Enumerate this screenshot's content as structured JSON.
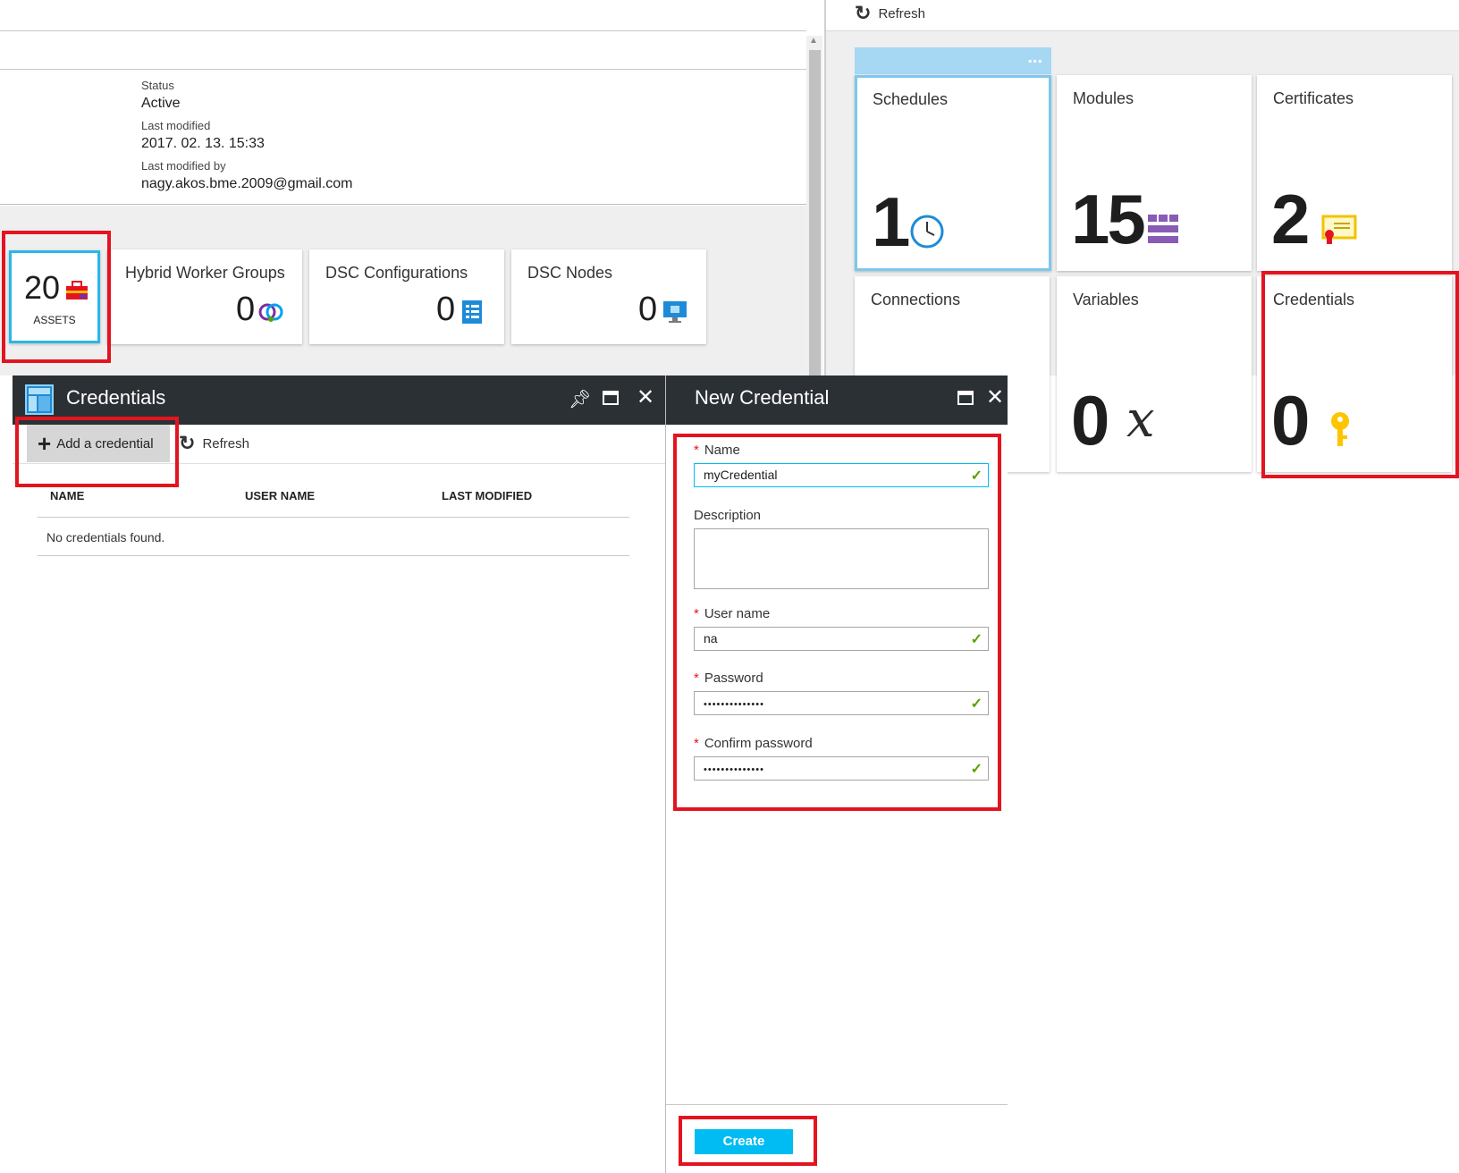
{
  "details": {
    "status_label": "Status",
    "status_value": "Active",
    "modified_label": "Last modified",
    "modified_value": "2017. 02. 13. 15:33",
    "modified_by_label": "Last modified by",
    "modified_by_value": "nagy.akos.bme.2009@gmail.com"
  },
  "summary_tiles": {
    "assets": {
      "count": "20",
      "label": "ASSETS",
      "icon": "toolbox-icon"
    },
    "hybrid": {
      "title": "Hybrid Worker Groups",
      "count": "0",
      "icon": "hybrid-worker-icon"
    },
    "dsc_configurations": {
      "title": "DSC Configurations",
      "count": "0",
      "icon": "checklist-icon"
    },
    "dsc_nodes": {
      "title": "DSC Nodes",
      "count": "0",
      "icon": "monitor-icon"
    }
  },
  "assets_panel": {
    "refresh_label": "Refresh",
    "more_label": "...",
    "tiles": [
      {
        "title": "Schedules",
        "count": "1",
        "icon": "clock-icon"
      },
      {
        "title": "Modules",
        "count": "15",
        "icon": "modules-grid-icon"
      },
      {
        "title": "Certificates",
        "count": "2",
        "icon": "certificate-icon"
      },
      {
        "title": "Connections",
        "count": "",
        "icon": ""
      },
      {
        "title": "Variables",
        "count": "0",
        "icon": "variable-x-icon",
        "symbol": "x"
      },
      {
        "title": "Credentials",
        "count": "0",
        "icon": "key-icon"
      }
    ]
  },
  "credentials_blade": {
    "title": "Credentials",
    "add_label": "Add a credential",
    "refresh_label": "Refresh",
    "columns": [
      "NAME",
      "USER NAME",
      "LAST MODIFIED"
    ],
    "empty_text": "No credentials found."
  },
  "new_credential": {
    "title": "New Credential",
    "name_label": "Name",
    "name_value": "myCredential",
    "description_label": "Description",
    "description_value": "",
    "username_label": "User name",
    "username_value": "na",
    "password_label": "Password",
    "password_value": "••••••••••••••",
    "confirm_label": "Confirm password",
    "confirm_value": "••••••••••••••",
    "create_label": "Create"
  },
  "colors": {
    "accent_blue": "#00bcf2",
    "highlight_red": "#e3141f",
    "blade_header": "#2b3035",
    "check_green": "#57a300"
  }
}
